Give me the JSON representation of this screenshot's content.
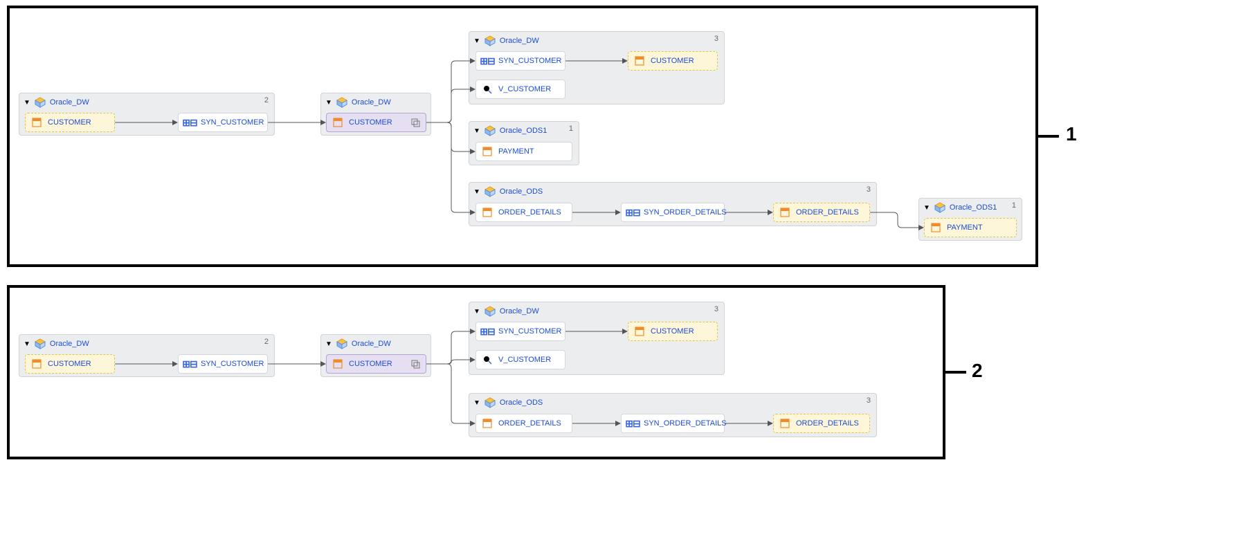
{
  "panels": [
    {
      "id": 1,
      "label": "1"
    },
    {
      "id": 2,
      "label": "2"
    }
  ],
  "containers": {
    "p1_c1": {
      "title": "Oracle_DW",
      "badge": "2"
    },
    "p1_c2": {
      "title": "Oracle_DW",
      "badge": ""
    },
    "p1_c3": {
      "title": "Oracle_DW",
      "badge": "3"
    },
    "p1_c4": {
      "title": "Oracle_ODS1",
      "badge": "1"
    },
    "p1_c5": {
      "title": "Oracle_ODS",
      "badge": "3"
    },
    "p1_c6": {
      "title": "Oracle_ODS1",
      "badge": "1"
    },
    "p2_c1": {
      "title": "Oracle_DW",
      "badge": "2"
    },
    "p2_c2": {
      "title": "Oracle_DW",
      "badge": ""
    },
    "p2_c3": {
      "title": "Oracle_DW",
      "badge": "3"
    },
    "p2_c5": {
      "title": "Oracle_ODS",
      "badge": "3"
    }
  },
  "nodes": {
    "p1_n_customer_src": {
      "label": "CUSTOMER"
    },
    "p1_n_syn_customer_1": {
      "label": "SYN_CUSTOMER"
    },
    "p1_n_customer_mid": {
      "label": "CUSTOMER"
    },
    "p1_n_syn_customer_2": {
      "label": "SYN_CUSTOMER"
    },
    "p1_n_v_customer": {
      "label": "V_CUSTOMER"
    },
    "p1_n_customer_tgt": {
      "label": "CUSTOMER"
    },
    "p1_n_payment_1": {
      "label": "PAYMENT"
    },
    "p1_n_order_details_1": {
      "label": "ORDER_DETAILS"
    },
    "p1_n_syn_order": {
      "label": "SYN_ORDER_DETAILS"
    },
    "p1_n_order_details_2": {
      "label": "ORDER_DETAILS"
    },
    "p1_n_payment_2": {
      "label": "PAYMENT"
    },
    "p2_n_customer_src": {
      "label": "CUSTOMER"
    },
    "p2_n_syn_customer_1": {
      "label": "SYN_CUSTOMER"
    },
    "p2_n_customer_mid": {
      "label": "CUSTOMER"
    },
    "p2_n_syn_customer_2": {
      "label": "SYN_CUSTOMER"
    },
    "p2_n_v_customer": {
      "label": "V_CUSTOMER"
    },
    "p2_n_customer_tgt": {
      "label": "CUSTOMER"
    },
    "p2_n_order_details_1": {
      "label": "ORDER_DETAILS"
    },
    "p2_n_syn_order": {
      "label": "SYN_ORDER_DETAILS"
    },
    "p2_n_order_details_2": {
      "label": "ORDER_DETAILS"
    }
  }
}
